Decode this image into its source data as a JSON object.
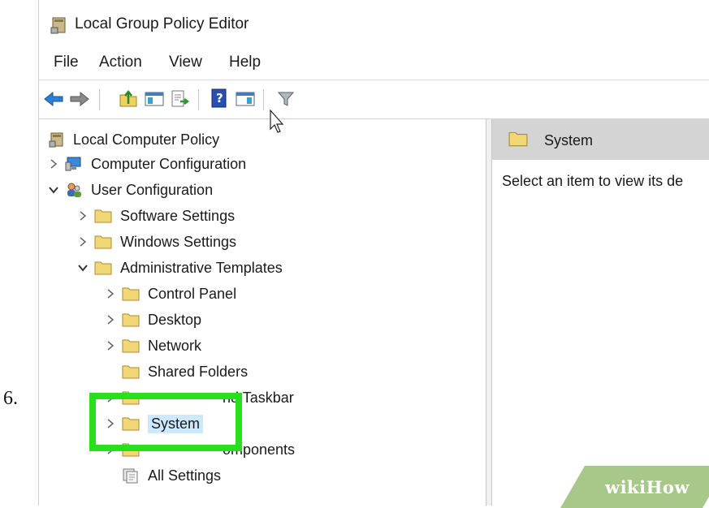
{
  "step_number": "6.",
  "window": {
    "title": "Local Group Policy Editor"
  },
  "menu": [
    "File",
    "Action",
    "View",
    "Help"
  ],
  "toolbar_icons": [
    "back-arrow-icon",
    "forward-arrow-icon",
    "up-folder-icon",
    "show-hide-tree-icon",
    "export-list-icon",
    "help-icon",
    "show-hide-action-pane-icon",
    "filter-icon"
  ],
  "tree": {
    "root": "Local Computer Policy",
    "computer_configuration": "Computer Configuration",
    "user_configuration": "User Configuration",
    "software_settings": "Software Settings",
    "windows_settings": "Windows Settings",
    "administrative_templates": "Administrative Templates",
    "control_panel": "Control Panel",
    "desktop": "Desktop",
    "network": "Network",
    "shared_folders": "Shared Folders",
    "start_menu_partial": "nd Taskbar",
    "system": "System",
    "windows_components_partial": "omponents",
    "all_settings": "All Settings"
  },
  "right_pane": {
    "header": "System",
    "description": "Select an item to view its de"
  },
  "watermark": "wikiHow",
  "colors": {
    "highlight": "#27e01b",
    "folder": "#f0d877",
    "header_bg": "#d4d4d4",
    "selected": "#cde8ff"
  }
}
